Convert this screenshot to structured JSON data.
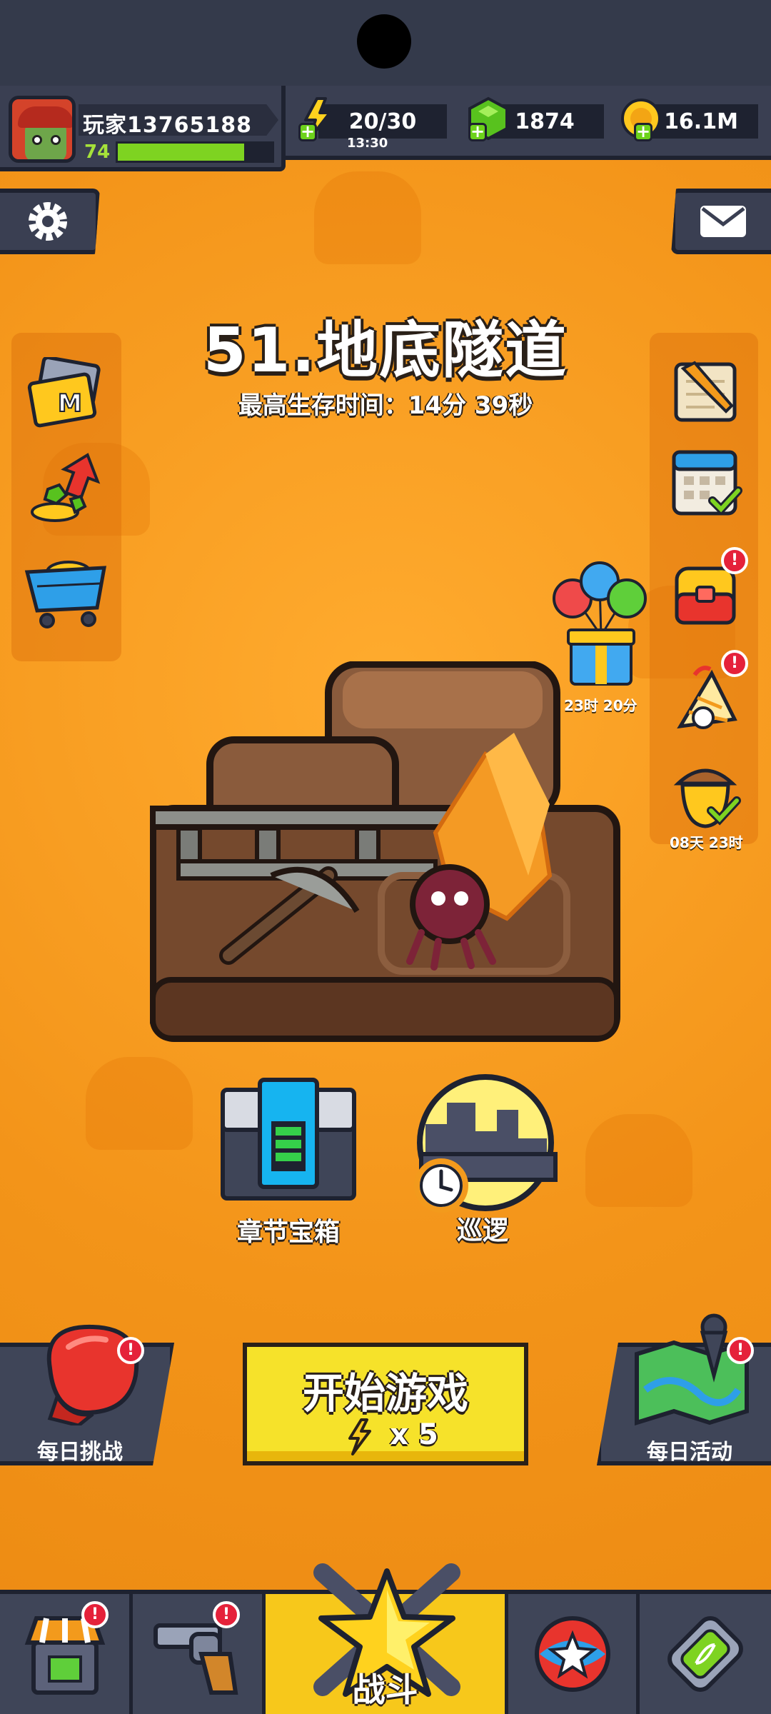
{
  "player": {
    "name": "玩家13765188",
    "level": "74",
    "xp_fraction": 0.82
  },
  "resources": {
    "energy": "20/30",
    "energy_timer": "13:30",
    "gems": "1874",
    "coins": "16.1M"
  },
  "stage": {
    "title": "51.地底隧道",
    "best_survival": "最高生存时间：14分 39秒"
  },
  "timers": {
    "balloon_gift": "23时 20分",
    "acorn_event": "08天 23时"
  },
  "features": {
    "chapter_chest_label": "章节宝箱",
    "patrol_label": "巡逻"
  },
  "actions": {
    "daily_challenge_label": "每日挑战",
    "start_game_label": "开始游戏",
    "start_cost": "x 5",
    "daily_event_label": "每日活动"
  },
  "nav": {
    "battle_label": "战斗"
  },
  "badges": {
    "alert": "!"
  },
  "colors": {
    "background": "#f39a1c",
    "bar": "#3a3f52",
    "accent_yellow": "#f6e22a",
    "gem_green": "#6dd21b",
    "alert_red": "#e5213a"
  }
}
